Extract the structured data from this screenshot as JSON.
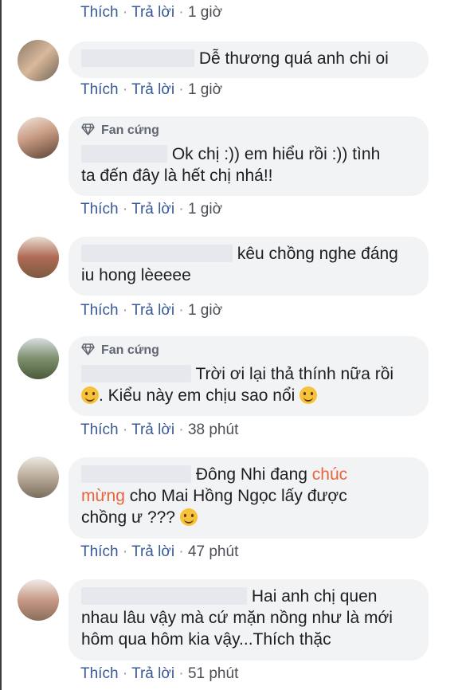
{
  "actions": {
    "like": "Thích",
    "reply": "Trả lời",
    "sep": "·"
  },
  "badge_label": "Fan cứng",
  "comments": [
    {
      "time": "1 giờ"
    },
    {
      "text": "Dễ thương quá anh chi oi",
      "time": "1 giờ"
    },
    {
      "line1": "Ok chị :)) em hiểu rồi :)) tình",
      "line2": "ta đến đây là hết chị nhá!!",
      "time": "1 giờ"
    },
    {
      "line1": "kêu chồng nghe đáng",
      "line2": "iu hong lèeeee",
      "time": "1 giờ"
    },
    {
      "line1": "Trời ơi lại thả thính nữa rồi",
      "line2": ". Kiểu này em chịu sao nổi",
      "time": "38 phút"
    },
    {
      "line1_a": "Đông Nhi đang ",
      "line1_b": "chúc",
      "line2_a": "mừng",
      "line2_b": " cho Mai Hồng Ngọc lấy được",
      "line3": "chồng ư ??? ",
      "time": "47 phút"
    },
    {
      "line1": "Hai anh chị quen",
      "line2": "nhau lâu vậy mà cứ mặn nồng như là mới",
      "line3": "hôm qua hôm kia vậy...Thích thặc",
      "time": "51 phút"
    }
  ],
  "colors": {
    "link": "#385898",
    "bubble": "#f2f3f5",
    "highlight": "#e8643c"
  }
}
